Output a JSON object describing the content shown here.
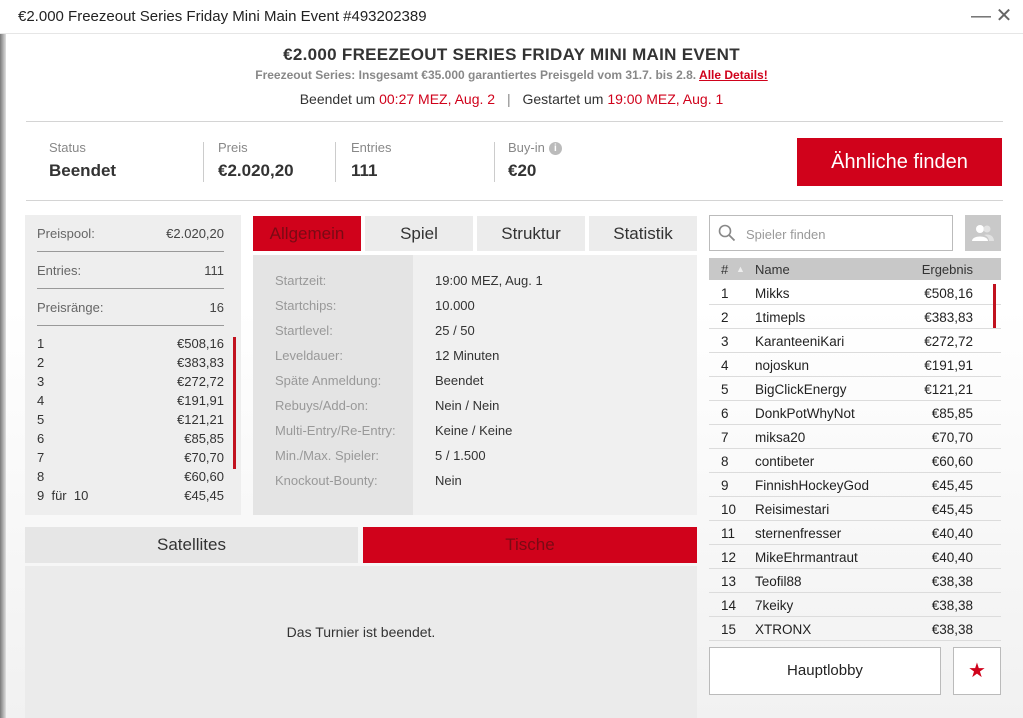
{
  "window": {
    "title": "€2.000 Freezeout Series Friday Mini Main Event #493202389",
    "minimize": "—",
    "close": "✕"
  },
  "header": {
    "title": "€2.000 FREEZEOUT SERIES FRIDAY MINI MAIN EVENT",
    "subtitle": "Freezeout Series: Insgesamt €35.000 garantiertes Preisgeld vom 31.7. bis 2.8.",
    "details_link": "Alle Details!",
    "ended_label": "Beendet um",
    "ended_time": "00:27 MEZ, Aug. 2",
    "separator": "|",
    "started_label": "Gestartet um",
    "started_time": "19:00 MEZ, Aug. 1"
  },
  "info": {
    "status_label": "Status",
    "status_value": "Beendet",
    "prize_label": "Preis",
    "prize_value": "€2.020,20",
    "entries_label": "Entries",
    "entries_value": "111",
    "buyin_label": "Buy-in",
    "buyin_value": "€20",
    "similar_button": "Ähnliche finden"
  },
  "prizepool": {
    "pool_label": "Preispool:",
    "pool_value": "€2.020,20",
    "entries_label": "Entries:",
    "entries_value": "111",
    "places_label": "Preisränge:",
    "places_value": "16",
    "payouts": [
      {
        "rank": "1",
        "amount": "€508,16"
      },
      {
        "rank": "2",
        "amount": "€383,83"
      },
      {
        "rank": "3",
        "amount": "€272,72"
      },
      {
        "rank": "4",
        "amount": "€191,91"
      },
      {
        "rank": "5",
        "amount": "€121,21"
      },
      {
        "rank": "6",
        "amount": "€85,85"
      },
      {
        "rank": "7",
        "amount": "€70,70"
      },
      {
        "rank": "8",
        "amount": "€60,60"
      },
      {
        "rank": "9  für  10",
        "amount": "€45,45"
      }
    ]
  },
  "tabs": [
    "Allgemein",
    "Spiel",
    "Struktur",
    "Statistik"
  ],
  "details": [
    {
      "label": "Startzeit:",
      "value": "19:00 MEZ, Aug. 1"
    },
    {
      "label": "Startchips:",
      "value": "10.000"
    },
    {
      "label": "Startlevel:",
      "value": "25 / 50"
    },
    {
      "label": "Leveldauer:",
      "value": "12 Minuten"
    },
    {
      "label": "Späte Anmeldung:",
      "value": "Beendet"
    },
    {
      "label": "Rebuys/Add-on:",
      "value": "Nein / Nein"
    },
    {
      "label": "Multi-Entry/Re-Entry:",
      "value": "Keine / Keine"
    },
    {
      "label": "Min./Max. Spieler:",
      "value": "5 / 1.500"
    },
    {
      "label": "Knockout-Bounty:",
      "value": "Nein"
    }
  ],
  "bottom_tabs": [
    "Satellites",
    "Tische"
  ],
  "end_message": "Das Turnier ist beendet.",
  "search": {
    "placeholder": "Spieler finden"
  },
  "players": {
    "headers": {
      "rank": "#",
      "name": "Name",
      "result": "Ergebnis"
    },
    "rows": [
      {
        "rank": "1",
        "name": "Mikks",
        "result": "€508,16"
      },
      {
        "rank": "2",
        "name": "1timepls",
        "result": "€383,83"
      },
      {
        "rank": "3",
        "name": "KaranteeniKari",
        "result": "€272,72"
      },
      {
        "rank": "4",
        "name": "nojoskun",
        "result": "€191,91"
      },
      {
        "rank": "5",
        "name": "BigClickEnergy",
        "result": "€121,21"
      },
      {
        "rank": "6",
        "name": "DonkPotWhyNot",
        "result": "€85,85"
      },
      {
        "rank": "7",
        "name": "miksa20",
        "result": "€70,70"
      },
      {
        "rank": "8",
        "name": "contibeter",
        "result": "€60,60"
      },
      {
        "rank": "9",
        "name": "FinnishHockeyGod",
        "result": "€45,45"
      },
      {
        "rank": "10",
        "name": "Reisimestari",
        "result": "€45,45"
      },
      {
        "rank": "11",
        "name": "sternenfresser",
        "result": "€40,40"
      },
      {
        "rank": "12",
        "name": "MikeEhrmantraut",
        "result": "€40,40"
      },
      {
        "rank": "13",
        "name": "Teofil88",
        "result": "€38,38"
      },
      {
        "rank": "14",
        "name": "7keiky",
        "result": "€38,38"
      },
      {
        "rank": "15",
        "name": "XTRONX",
        "result": "€38,38"
      }
    ]
  },
  "lobby_button": "Hauptlobby",
  "favorite_icon": "★",
  "colors": {
    "accent": "#d0021b",
    "panel": "#eeeeee"
  }
}
